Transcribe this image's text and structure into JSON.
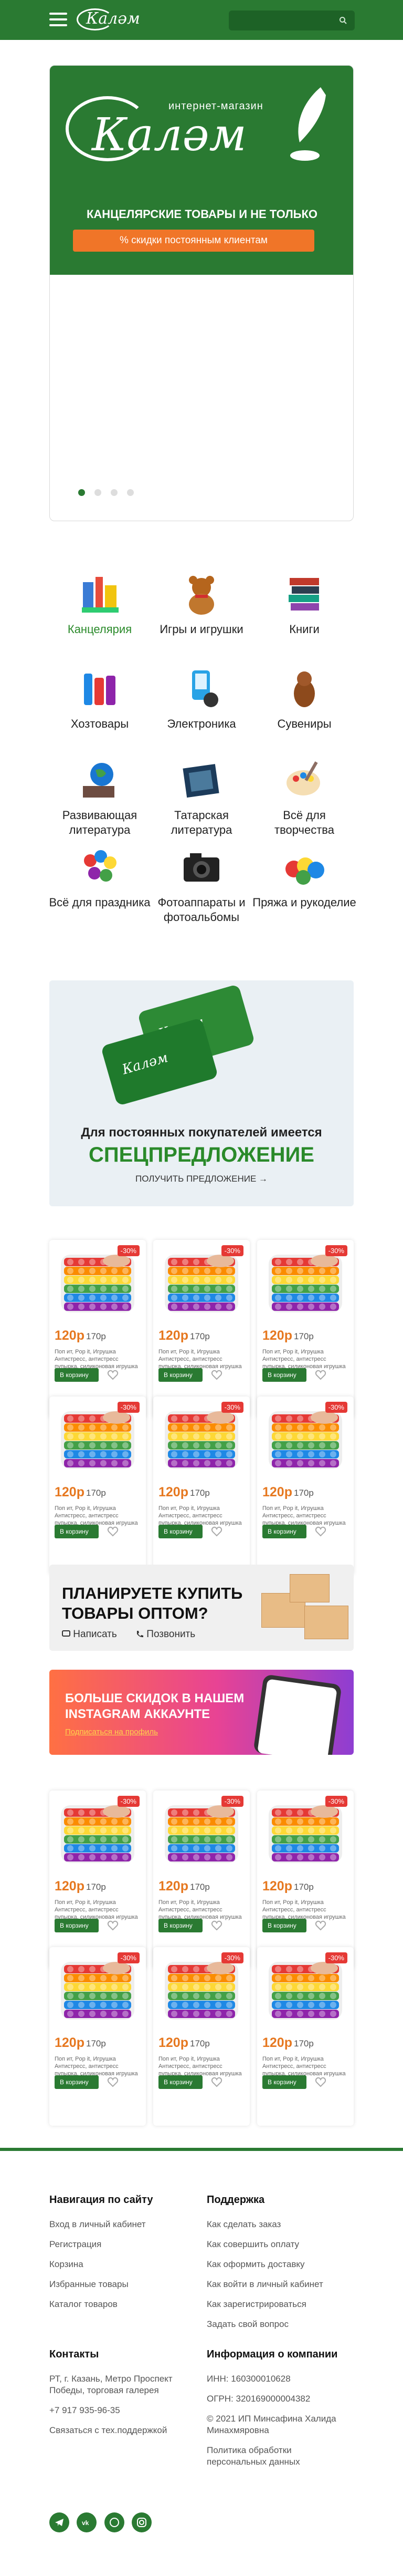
{
  "header": {
    "logo": "Калəм",
    "search_placeholder": "",
    "colors": {
      "brand": "#2a7a32",
      "accent": "#f07528"
    }
  },
  "banner": {
    "subtitle": "интернет-магазин",
    "logo": "Калəм",
    "tagline": "КАНЦЕЛЯРСКИЕ ТОВАРЫ И НЕ ТОЛЬКО",
    "button": "% скидки постоянным клиентам",
    "slides_total": 4,
    "active_slide": 1
  },
  "categories": [
    {
      "label": "Канцелярия",
      "icon": "stationery-icon"
    },
    {
      "label": "Игры и игрушки",
      "icon": "teddy-bear-icon"
    },
    {
      "label": "Книги",
      "icon": "books-icon"
    },
    {
      "label": "Хозтовары",
      "icon": "household-icon"
    },
    {
      "label": "Электроника",
      "icon": "electronics-icon"
    },
    {
      "label": "Сувениры",
      "icon": "souvenir-icon"
    },
    {
      "label": "Развивающая литература",
      "icon": "globe-icon"
    },
    {
      "label": "Татарская литература",
      "icon": "carpet-book-icon"
    },
    {
      "label": "Всё для творчества",
      "icon": "paint-palette-icon"
    },
    {
      "label": "Всё для праздника",
      "icon": "balloons-icon"
    },
    {
      "label": "Фотоаппараты и фотоальбомы",
      "icon": "camera-icon"
    },
    {
      "label": "Пряжа и рукоделие",
      "icon": "yarn-icon"
    }
  ],
  "promo": {
    "card_logo": "Калəм",
    "line1": "Для постоянных покупателей имеется",
    "line2": "СПЕЦПРЕДЛОЖЕНИЕ",
    "link": "ПОЛУЧИТЬ ПРЕДЛОЖЕНИЕ →"
  },
  "product": {
    "badge": "-30%",
    "price": "120р",
    "old_price": "170р",
    "description": "Поп ит, Pop it, Игрушка Антистресс, антистресс пупырка, силиконовая игрушка",
    "cart": "В корзину"
  },
  "wholesale": {
    "title_line1": "ПЛАНИРУЕТЕ КУПИТЬ",
    "title_line2": "ТОВАРЫ ОПТОМ?",
    "write": "Написать",
    "call": "Позвонить"
  },
  "instagram": {
    "line1": "БОЛЬШЕ СКИДОК В НАШЕМ",
    "line2": "INSTAGRAM АККАУНТЕ",
    "link": "Подписаться на профиль"
  },
  "footer": {
    "nav_title": "Навигация по сайту",
    "nav": [
      "Вход в личный кабинет",
      "Регистрация",
      "Корзина",
      "Избранные товары",
      "Каталог товаров"
    ],
    "support_title": "Поддержка",
    "support": [
      "Как сделать заказ",
      "Как совершить оплату",
      "Как оформить доставку",
      "Как войти в личный кабинет",
      "Как зарегистрироваться",
      "Задать свой вопрос"
    ],
    "contacts_title": "Контакты",
    "contacts": [
      "РТ, г. Казань, Метро Проспект Победы, торговая галерея",
      "+7 917 935-96-35",
      "Связаться с тех.поддержкой"
    ],
    "company_title": "Информация о компании",
    "company": [
      "ИНН: 160300010628",
      "ОГРН: 320169000004382",
      "© 2021 ИП Минсафина Халида Минахмяровна",
      "Политика обработки персональных данных"
    ],
    "social": [
      "telegram-icon",
      "vk-icon",
      "whatsapp-icon",
      "instagram-icon"
    ]
  }
}
